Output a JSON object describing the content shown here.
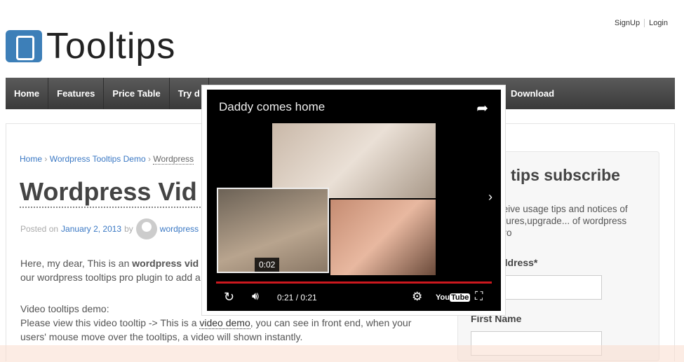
{
  "header": {
    "signup": "SignUp",
    "login": "Login",
    "logo_text": "Tooltips"
  },
  "nav": {
    "items": [
      "Home",
      "Features",
      "Price Table",
      "Try d"
    ],
    "download": "Download"
  },
  "breadcrumb": {
    "home": "Home",
    "sep": "›",
    "demo": "Wordpress Tooltips Demo",
    "current": "Wordpress"
  },
  "post": {
    "title": "Wordpress Vid",
    "posted_on": "Posted on",
    "date": "January 2, 2013",
    "by": "by",
    "author": "wordpress",
    "p1_a": "Here, my dear, This is an ",
    "p1_b": "wordpress vid",
    "p1_line2": "our wordpress tooltips pro plugin to add a",
    "p2_line1": "Video tooltips demo:",
    "p2_a": "Please view this video tooltip -> This is a ",
    "p2_link": "video demo",
    "p2_b": ", you can see in front end, when your",
    "p2_line3": "users' mouse move over the tooltips, a video will shown instantly."
  },
  "sidebar": {
    "title": "tips subscribe",
    "desc": "ceive usage tips and notices of ... atures,upgrade... of wordpress ... pro",
    "desc_l1": "ceive usage tips and notices of",
    "desc_l2": "atures,upgrade... of wordpress",
    "desc_l3": "pro",
    "email_label": "ddress*",
    "first_name_label": "First Name"
  },
  "video": {
    "title": "Daddy comes home",
    "preview_time": "0:02",
    "time": "0:21 / 0:21",
    "progress_percent": 100,
    "brand": "YouTube",
    "accent": "#cc181e"
  }
}
